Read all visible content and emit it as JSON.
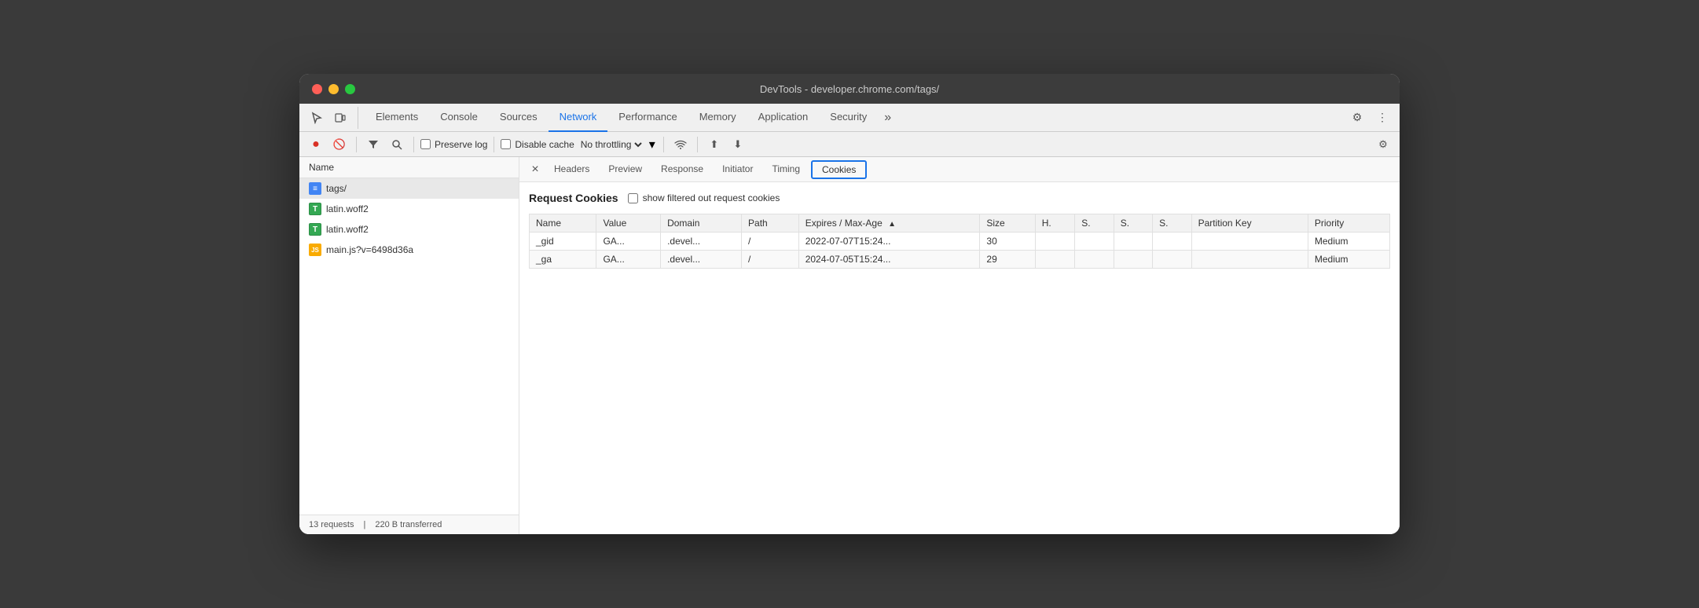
{
  "window": {
    "title": "DevTools - developer.chrome.com/tags/"
  },
  "traffic_lights": {
    "red_label": "close",
    "yellow_label": "minimize",
    "green_label": "maximize"
  },
  "devtools": {
    "tabs": [
      {
        "id": "elements",
        "label": "Elements",
        "active": false
      },
      {
        "id": "console",
        "label": "Console",
        "active": false
      },
      {
        "id": "sources",
        "label": "Sources",
        "active": false
      },
      {
        "id": "network",
        "label": "Network",
        "active": true
      },
      {
        "id": "performance",
        "label": "Performance",
        "active": false
      },
      {
        "id": "memory",
        "label": "Memory",
        "active": false
      },
      {
        "id": "application",
        "label": "Application",
        "active": false
      },
      {
        "id": "security",
        "label": "Security",
        "active": false
      }
    ],
    "overflow_label": "»",
    "gear_label": "⚙",
    "more_label": "⋮"
  },
  "toolbar": {
    "record_label": "●",
    "block_label": "🚫",
    "filter_label": "▽",
    "search_label": "🔍",
    "preserve_log_label": "Preserve log",
    "disable_cache_label": "Disable cache",
    "throttle_label": "No throttling",
    "wifi_label": "📶",
    "upload_label": "⬆",
    "download_label": "⬇",
    "gear2_label": "⚙"
  },
  "file_panel": {
    "header": "Name",
    "files": [
      {
        "id": "tags",
        "name": "tags/",
        "icon_type": "html",
        "icon_label": "≡",
        "selected": true
      },
      {
        "id": "latin1",
        "name": "latin.woff2",
        "icon_type": "font",
        "icon_label": "T",
        "selected": false
      },
      {
        "id": "latin2",
        "name": "latin.woff2",
        "icon_type": "font",
        "icon_label": "T",
        "selected": false
      },
      {
        "id": "mainjs",
        "name": "main.js?v=6498d36a",
        "icon_type": "js",
        "icon_label": "JS",
        "selected": false
      }
    ],
    "status_requests": "13 requests",
    "status_separator": "|",
    "status_transferred": "220 B transferred"
  },
  "detail_panel": {
    "tabs": [
      {
        "id": "close",
        "label": "×"
      },
      {
        "id": "headers",
        "label": "Headers"
      },
      {
        "id": "preview",
        "label": "Preview"
      },
      {
        "id": "response",
        "label": "Response"
      },
      {
        "id": "initiator",
        "label": "Initiator"
      },
      {
        "id": "timing",
        "label": "Timing"
      },
      {
        "id": "cookies",
        "label": "Cookies",
        "active": true
      }
    ]
  },
  "cookies": {
    "section_title": "Request Cookies",
    "show_filtered_label": "show filtered out request cookies",
    "table": {
      "headers": [
        {
          "id": "name",
          "label": "Name"
        },
        {
          "id": "value",
          "label": "Value"
        },
        {
          "id": "domain",
          "label": "Domain"
        },
        {
          "id": "path",
          "label": "Path"
        },
        {
          "id": "expires",
          "label": "Expires / Max-Age",
          "sort": "▲"
        },
        {
          "id": "size",
          "label": "Size"
        },
        {
          "id": "h",
          "label": "H."
        },
        {
          "id": "s1",
          "label": "S."
        },
        {
          "id": "s2",
          "label": "S."
        },
        {
          "id": "s3",
          "label": "S."
        },
        {
          "id": "partition_key",
          "label": "Partition Key"
        },
        {
          "id": "priority",
          "label": "Priority"
        }
      ],
      "rows": [
        {
          "name": "_gid",
          "value": "GA...",
          "domain": ".devel...",
          "path": "/",
          "expires": "2022-07-07T15:24...",
          "size": "30",
          "h": "",
          "s1": "",
          "s2": "",
          "s3": "",
          "partition_key": "",
          "priority": "Medium"
        },
        {
          "name": "_ga",
          "value": "GA...",
          "domain": ".devel...",
          "path": "/",
          "expires": "2024-07-05T15:24...",
          "size": "29",
          "h": "",
          "s1": "",
          "s2": "",
          "s3": "",
          "partition_key": "",
          "priority": "Medium"
        }
      ]
    }
  }
}
